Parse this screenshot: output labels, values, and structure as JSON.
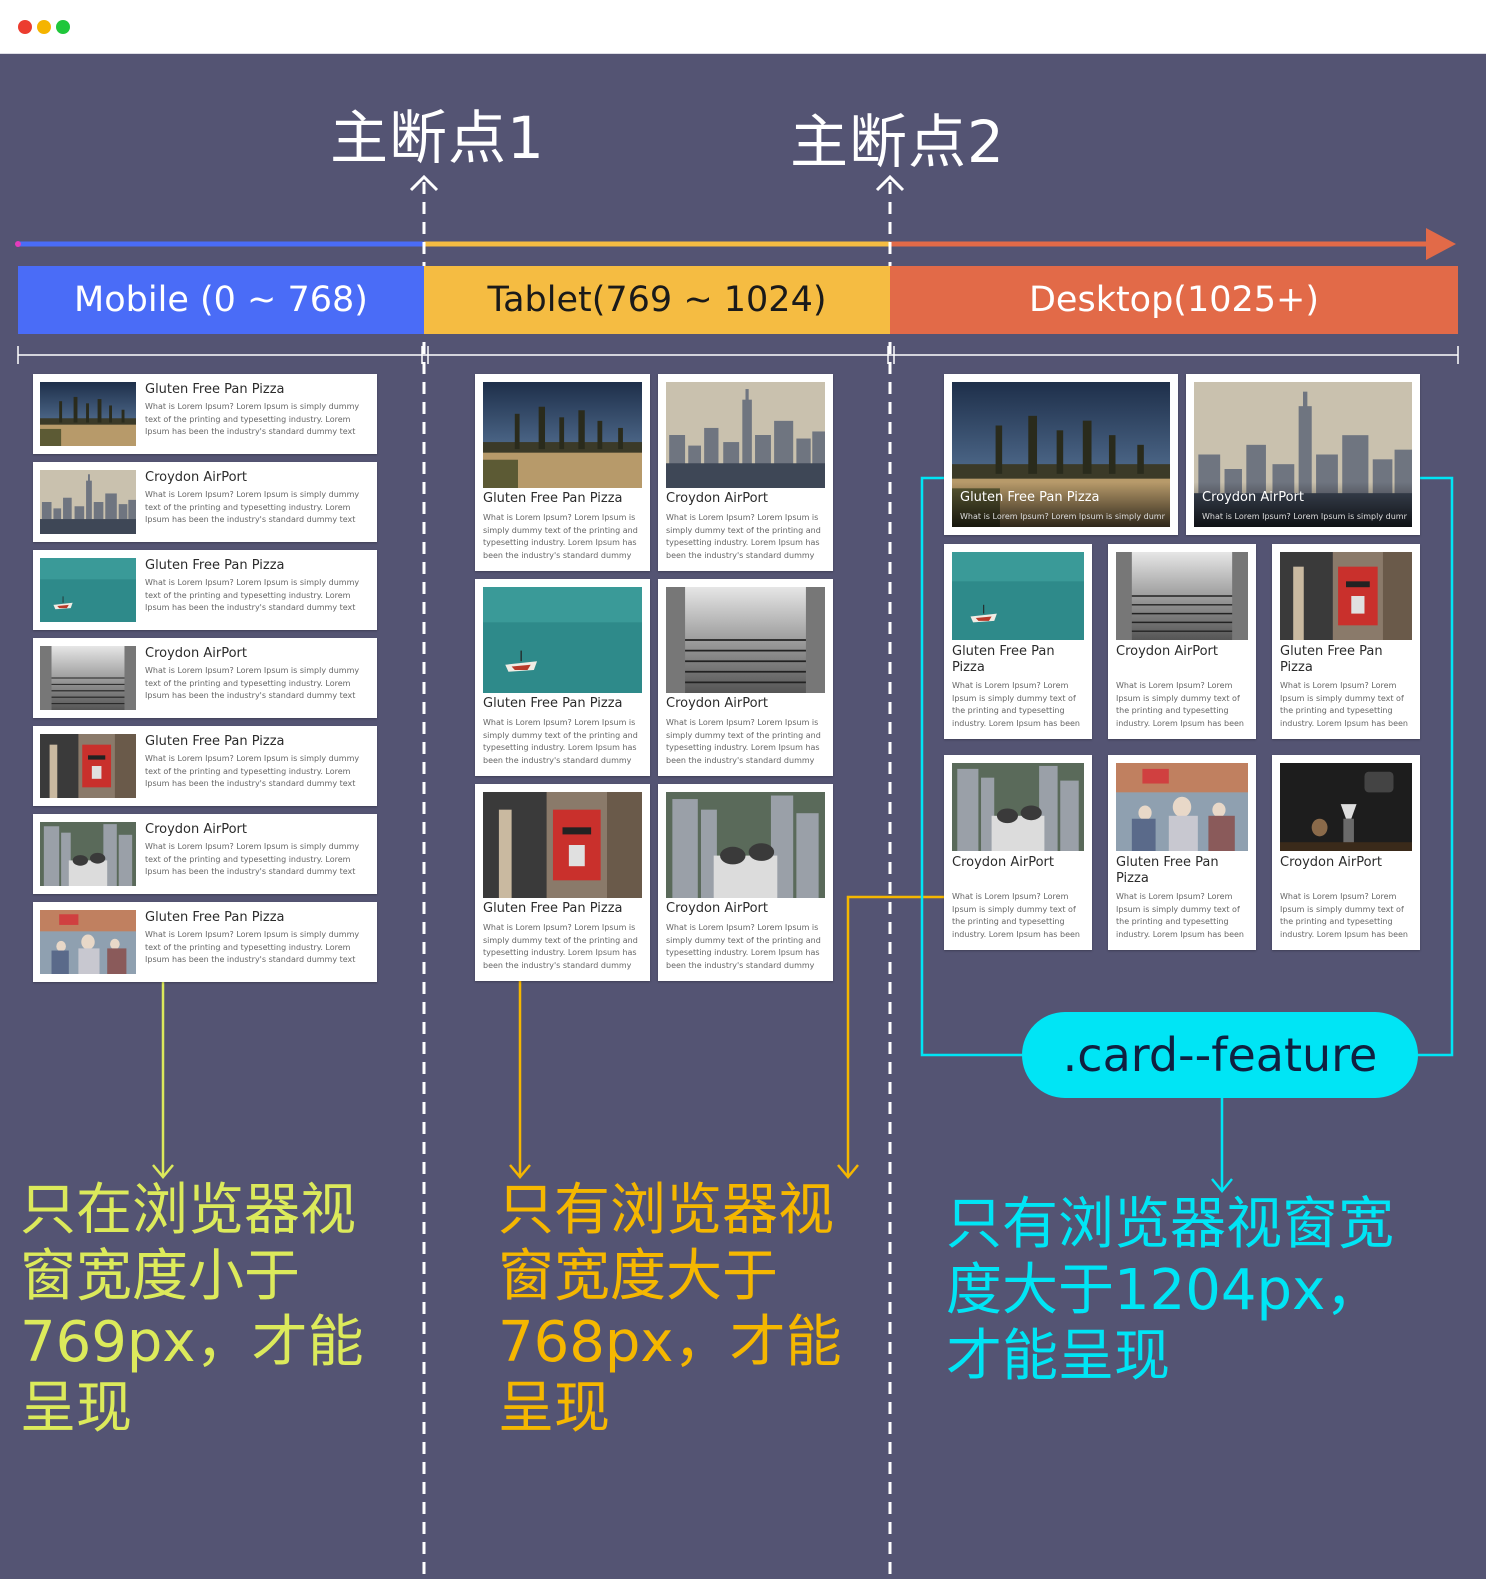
{
  "colors": {
    "background": "#545473",
    "mobile": "#4a6cf7",
    "tablet": "#f5bc42",
    "desktop": "#e26a48",
    "mobile_note": "#dcea5b",
    "tablet_note": "#f5b700",
    "feature": "#00e5f5"
  },
  "breakpoints": {
    "bp1": "主断点1",
    "bp2": "主断点2"
  },
  "bands": {
    "mobile": "Mobile (0 ~ 768)",
    "tablet": "Tablet(769 ~ 1024)",
    "desktop": "Desktop(1025+)"
  },
  "cards": {
    "pizza": "Gluten Free Pan Pizza",
    "airport": "Croydon AirPort",
    "body_mobile": "What is Lorem Ipsum? Lorem Ipsum is simply dummy text of the printing and typesetting industry. Lorem Ipsum has been the industry's standard dummy text ever since the...",
    "body_tablet": "What is Lorem Ipsum? Lorem Ipsum is simply dummy text of the printing and typesetting industry. Lorem Ipsum has been the industry's standard dummy tex...",
    "body_desktop": "What is Lorem Ipsum? Lorem Ipsum is simply dummy text of the printing and typesetting industry. Lorem Ipsum has been the...",
    "body_feature": "What is Lorem Ipsum? Lorem Ipsum is simply dumm..."
  },
  "feature_label": ".card--feature",
  "notes": {
    "mobile": "只在浏览器视窗宽度小于769px，才能呈现",
    "tablet": "只有浏览器视窗宽度大于768px，才能呈现",
    "desktop": "只有浏览器视窗宽度大于1204px，才能呈现"
  }
}
